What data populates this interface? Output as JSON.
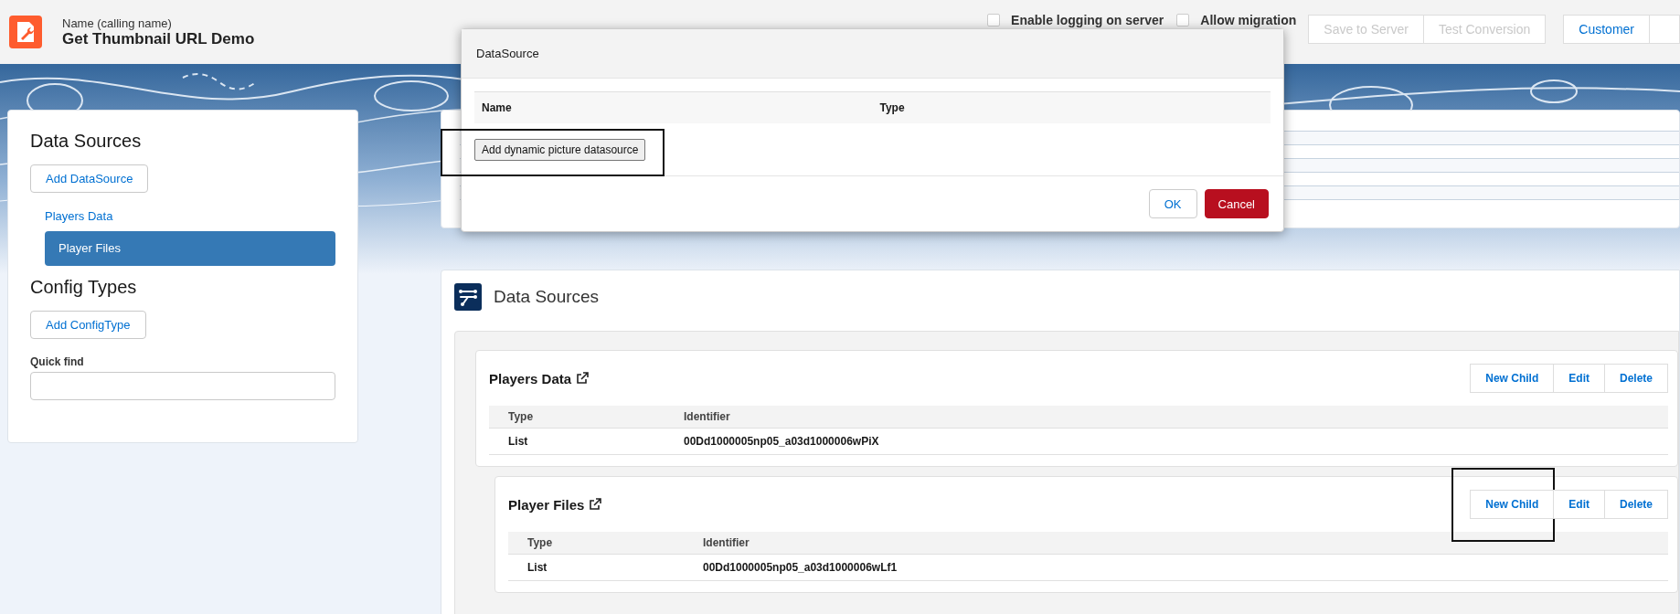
{
  "header": {
    "subtitle": "Name (calling name)",
    "title": "Get Thumbnail URL Demo",
    "options": [
      {
        "label": "Enable logging on server",
        "checked": false
      },
      {
        "label": "Allow migration",
        "checked": false
      }
    ],
    "actions": [
      {
        "label": "Save to Server",
        "disabled": true
      },
      {
        "label": "Test Conversion",
        "disabled": true
      }
    ],
    "view_buttons": [
      {
        "label": "Customer"
      }
    ]
  },
  "sidebar": {
    "sections": [
      {
        "title": "Data Sources",
        "add_button": "Add DataSource",
        "items": [
          {
            "label": "Players Data",
            "selected": false
          },
          {
            "label": "Player Files",
            "selected": true
          }
        ]
      },
      {
        "title": "Config Types",
        "add_button": "Add ConfigType"
      }
    ],
    "quick_find": {
      "label": "Quick find"
    }
  },
  "main": {
    "title": "Data Sources",
    "sources": [
      {
        "name": "Players Data",
        "buttons": [
          {
            "label": "New Child",
            "highlighted": false
          },
          {
            "label": "Edit",
            "highlighted": false
          },
          {
            "label": "Delete",
            "highlighted": false
          }
        ],
        "columns": [
          "Type",
          "Identifier"
        ],
        "rows": [
          [
            "List",
            "00Dd1000005np05_a03d1000006wPiX"
          ]
        ],
        "children": [
          {
            "name": "Player Files",
            "buttons": [
              {
                "label": "New Child",
                "highlighted": true
              },
              {
                "label": "Edit",
                "highlighted": false
              },
              {
                "label": "Delete",
                "highlighted": false
              }
            ],
            "columns": [
              "Type",
              "Identifier"
            ],
            "rows": [
              [
                "List",
                "00Dd1000005np05_a03d1000006wLf1"
              ]
            ]
          }
        ]
      }
    ]
  },
  "modal": {
    "title": "DataSource",
    "columns": [
      "Name",
      "Type"
    ],
    "add_button": {
      "label": "Add dynamic picture datasource",
      "highlighted": true
    },
    "ok": "OK",
    "cancel": "Cancel"
  }
}
